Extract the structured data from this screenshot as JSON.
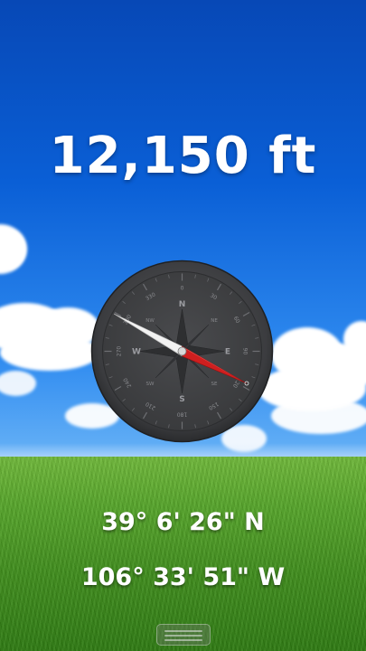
{
  "altitude": {
    "value": "12,150 ft"
  },
  "compass": {
    "cardinals": {
      "north": "N",
      "east": "E",
      "south": "S",
      "west": "W"
    },
    "intercardinals": {
      "ne": "NE",
      "se": "SE",
      "sw": "SW",
      "nw": "NW"
    },
    "degree_labels": [
      "0",
      "30",
      "60",
      "90",
      "120",
      "150",
      "180",
      "210",
      "240",
      "270",
      "300",
      "330"
    ],
    "needle_colors": {
      "north": "#f2f2f2",
      "south": "#cf1f1f"
    },
    "dial_color": "#3a3b3d"
  },
  "location": {
    "latitude": "39° 6' 26\" N",
    "longitude": "106° 33' 51\" W"
  }
}
